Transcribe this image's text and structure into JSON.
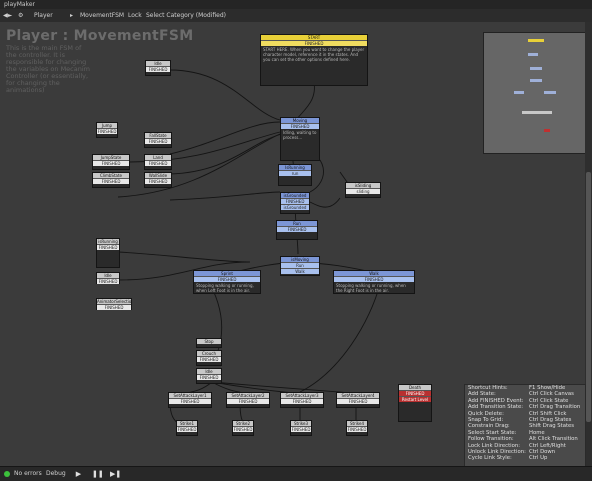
{
  "window": {
    "title": "playMaker"
  },
  "toolbar": {
    "object": "Player",
    "fsm": "MovementFSM",
    "lock": "Lock",
    "state_dropdown": "Select Category (Modified)"
  },
  "fsm": {
    "title": "Player : MovementFSM",
    "description": "This is the main FSM of the controller. It is responsible for changing the variables on Mecanim Controller (or essentially, for changing the animations)"
  },
  "states": {
    "start": {
      "title": "START",
      "event": "FINISHED",
      "note": "START HERE. When you want to change the player character model, reference it in the states. And you can set the other options defined here."
    },
    "idle": {
      "title": "Idle",
      "event": "FINISHED"
    },
    "moving": {
      "title": "Moving",
      "event": "FINISHED",
      "note": "Idling, waiting to process..."
    },
    "jump": {
      "title": "Jump",
      "event1": "FINISHED",
      "event2": "jump"
    },
    "jump_state": {
      "title": "JumpState",
      "event": "FINISHED"
    },
    "fall_state": {
      "title": "FallState",
      "event": "FINISHED"
    },
    "land": {
      "title": "Land",
      "event": "FINISHED"
    },
    "fall": {
      "title": "FallingState",
      "event": "FINISHED"
    },
    "wall": {
      "title": "WallSlide",
      "event": "FINISHED"
    },
    "climbstate": {
      "title": "ClimbState",
      "event": "FINISHED"
    },
    "is_grounded": {
      "title": "isGrounded",
      "event1": "FINISHED",
      "event2": "isGrounded"
    },
    "is_sliding": {
      "title": "isSliding",
      "event": "sliding"
    },
    "run": {
      "title": "Run",
      "event": "FINISHED",
      "note": "Running state"
    },
    "is_running": {
      "title": "IsRunning",
      "event": "run"
    },
    "idle2": {
      "title": "Idle",
      "event": "FINISHED"
    },
    "animated": {
      "title": "AnimatorSelection",
      "event": "FINISHED"
    },
    "sprint": {
      "title": "Sprint",
      "event": "FINISHED",
      "note": "Stopping walking or running, when Left Foot is in the air."
    },
    "walk": {
      "title": "Walk",
      "event": "FINISHED",
      "note": "Stopping walking or running, when the Right Foot is in the air."
    },
    "crouch": {
      "title": "Crouch",
      "event": "FINISHED"
    },
    "is_moving": {
      "title": "isMoving",
      "event1": "Run",
      "event2": "Walk"
    },
    "stop": {
      "title": "Stop",
      "event": "FINISHED"
    },
    "is_running2": {
      "title": "isRunning",
      "event": "FINISHED"
    },
    "idle_state": {
      "title": "Idle",
      "event": "FINISHED"
    },
    "attack1": {
      "title": "SetAttackLayer1",
      "event": "FINISHED"
    },
    "attack2": {
      "title": "SetAttackLayer2",
      "event": "FINISHED"
    },
    "attack3": {
      "title": "SetAttackLayer3",
      "event": "FINISHED"
    },
    "attack4": {
      "title": "SetAttackLayer4",
      "event": "FINISHED"
    },
    "attack5": {
      "title": "SetAttackLayer5",
      "event": "FINISHED"
    },
    "strike1": {
      "title": "Strike1",
      "event": "FINISHED"
    },
    "strike2": {
      "title": "Strike2",
      "event": "FINISHED"
    },
    "strike3": {
      "title": "Strike3",
      "event": "FINISHED"
    },
    "strike4": {
      "title": "Strike4",
      "event": "FINISHED"
    },
    "strike5": {
      "title": "Strike5",
      "event": "FINISHED"
    },
    "death": {
      "title": "Death",
      "event1": "FINISHED",
      "event2": "Restart Level"
    }
  },
  "hints": [
    {
      "k": "Shortcut Hints:",
      "v": "F1 Show/Hide"
    },
    {
      "k": "Add State:",
      "v": "Ctrl Click Canvas"
    },
    {
      "k": "Add FINISHED Event:",
      "v": "Ctrl Click State"
    },
    {
      "k": "Add Transition State:",
      "v": "Ctrl Drag Transition"
    },
    {
      "k": "Quick Delete:",
      "v": "Ctrl Shift Click"
    },
    {
      "k": "Snap To Grid:",
      "v": "Ctrl Drag States"
    },
    {
      "k": "Constrain Drag:",
      "v": "Shift Drag States"
    },
    {
      "k": "Select Start State:",
      "v": "Home"
    },
    {
      "k": "Follow Transition:",
      "v": "Alt Click Transition"
    },
    {
      "k": "Lock Link Direction:",
      "v": "Ctrl Left/Right"
    },
    {
      "k": "Unlock Link Direction:",
      "v": "Ctrl Down"
    },
    {
      "k": "Cycle Link Style:",
      "v": "Ctrl Up"
    }
  ],
  "bottombar": {
    "status": "No errors",
    "debug": "Debug"
  }
}
